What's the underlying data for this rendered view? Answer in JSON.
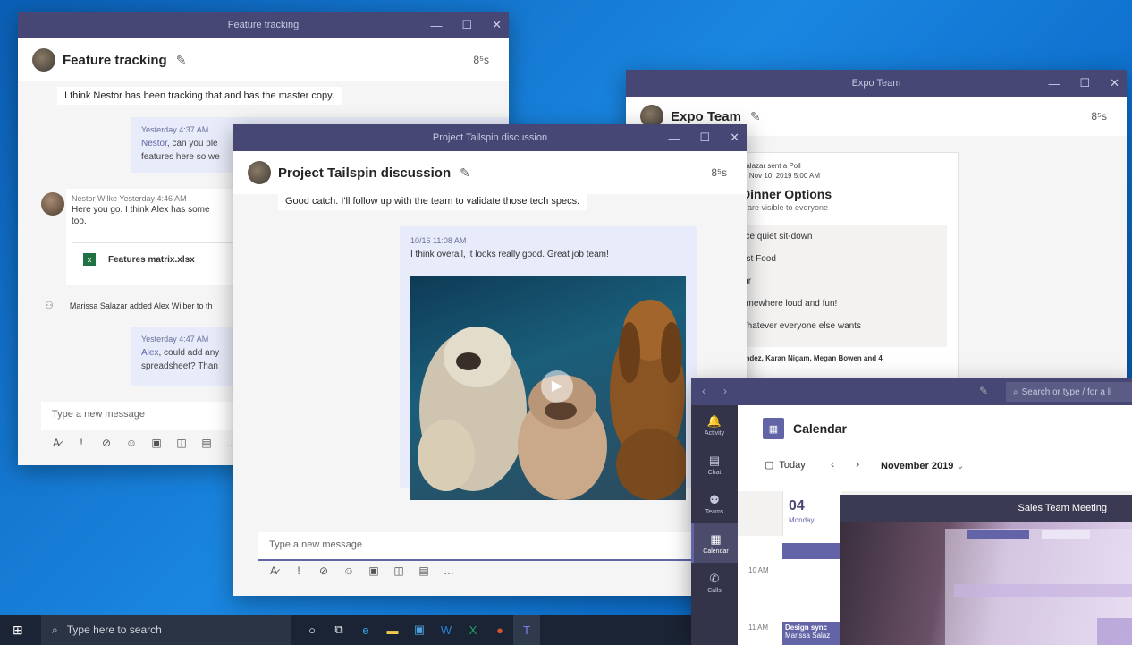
{
  "win_feature": {
    "title": "Feature tracking",
    "chat_title": "Feature tracking",
    "people": "8⁵s",
    "msg1": "I think Nestor has been tracking that and has the master copy.",
    "b1_meta": "Yesterday 4:37 AM",
    "b1_name": "Nestor",
    "b1_text": ", can you ple",
    "b1_text2": "features here so we",
    "nestor_meta": "Nestor Wilke   Yesterday 4:46 AM",
    "nestor_text": "Here you go.  I think Alex has some",
    "nestor_text2": "too.",
    "file_name": "Features matrix.xlsx",
    "added_text": "Marissa Salazar added Alex Wilber to th",
    "b2_meta": "Yesterday 4:47 AM",
    "b2_name": "Alex",
    "b2_text": ", could add any",
    "b2_text2": "spreadsheet?  Than",
    "composer": "Type a new message"
  },
  "win_tailspin": {
    "title": "Project Tailspin discussion",
    "chat_title": "Project Tailspin discussion",
    "people": "8⁵s",
    "msg1": "Good catch.  I'll follow up with the team to validate those tech specs.",
    "b_meta": "10/16 11:08 AM",
    "b_text": "I think overall, it looks really good.  Great job team!",
    "composer": "Type a new message"
  },
  "win_expo": {
    "title": "Expo Team",
    "chat_title": "Expo Team",
    "people": "8⁵s",
    "poll_meta1": "Salazar sent a Poll",
    "poll_meta2": "n, Nov 10, 2019 5:00 AM",
    "poll_title": "Dinner Options",
    "poll_sub": "s are visible to everyone",
    "options": [
      "lice quiet sit-down",
      "ast Food",
      "lar",
      "omewhere loud and fun!",
      "Vhatever everyone else wants"
    ],
    "footer": "andez, Karan Nigam, Megan Bowen and 4"
  },
  "win_calendar": {
    "search": "Search or type / for a li",
    "page_title": "Calendar",
    "today": "Today",
    "month": "November 2019",
    "day_num": "04",
    "day_name": "Monday",
    "time1": "10 AM",
    "time2": "11 AM",
    "event": "Design sync",
    "event_sub": "Marissa Salaz",
    "rail": [
      "Activity",
      "Chat",
      "Teams",
      "Calendar",
      "Calls"
    ],
    "meeting_title": "Sales Team Meeting"
  },
  "taskbar": {
    "search_placeholder": "Type here to search"
  }
}
